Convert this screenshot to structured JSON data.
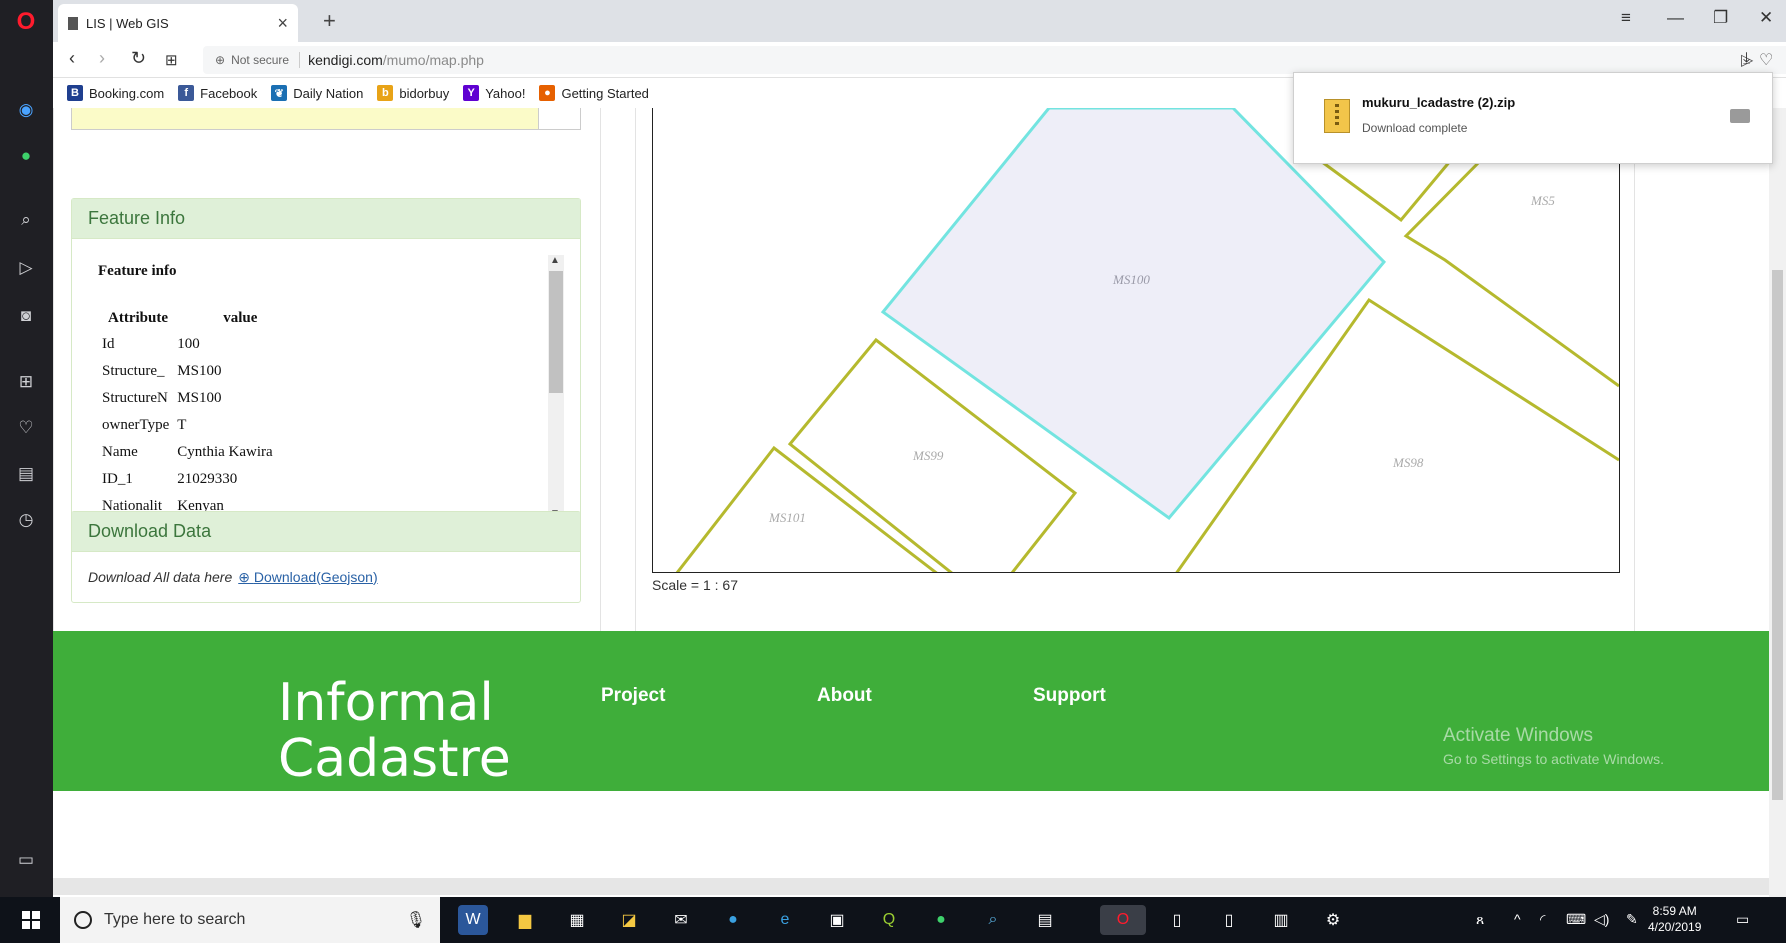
{
  "browser": {
    "tab_title": "LIS | Web GIS",
    "tab_close": "×",
    "new_tab": "+",
    "url_security": "Not secure",
    "url_host": "kendigi.com",
    "url_path": "/mumo/map.php",
    "bookmarks": [
      {
        "label": "Booking.com",
        "icon": "B",
        "color": "#1f3f8f"
      },
      {
        "label": "Facebook",
        "icon": "f",
        "color": "#3b5998"
      },
      {
        "label": "Daily Nation",
        "icon": "❦",
        "color": "#1b6fb3"
      },
      {
        "label": "bidorbuy",
        "icon": "b",
        "color": "#e8a317"
      },
      {
        "label": "Yahoo!",
        "icon": "Y",
        "color": "#5f01d1"
      },
      {
        "label": "Getting Started",
        "icon": "●",
        "color": "#e66000"
      }
    ]
  },
  "download_popup": {
    "filename": "mukuru_lcadastre (2).zip",
    "status": "Download complete"
  },
  "feature_info": {
    "header": "Feature Info",
    "title": "Feature info",
    "col_attribute": "Attribute",
    "col_value": "value",
    "rows": [
      {
        "attr": "Id",
        "value": "100"
      },
      {
        "attr": "Structure_",
        "value": "MS100"
      },
      {
        "attr": "StructureN",
        "value": "MS100"
      },
      {
        "attr": "ownerType",
        "value": "T"
      },
      {
        "attr": "Name",
        "value": "Cynthia Kawira"
      },
      {
        "attr": "ID_1",
        "value": "21029330"
      },
      {
        "attr": "Nationalit",
        "value": "Kenyan"
      }
    ]
  },
  "download_data": {
    "header": "Download Data",
    "text": "Download All data here",
    "link": "Download(Geojson)"
  },
  "map": {
    "parcel_labels": [
      "MS100",
      "MS99",
      "MS101",
      "MS98",
      "MS5"
    ],
    "selected_color": "#73e4e0",
    "parcel_color": "#b5b92e",
    "scale": "Scale = 1 : 67"
  },
  "footer": {
    "brand_line1": "Informal",
    "brand_line2": "Cadastre",
    "links": [
      "Project",
      "About",
      "Support"
    ],
    "watermark_line1": "Activate Windows",
    "watermark_line2": "Go to Settings to activate Windows."
  },
  "taskbar": {
    "search_placeholder": "Type here to search",
    "time": "8:59 AM",
    "date": "4/20/2019"
  }
}
